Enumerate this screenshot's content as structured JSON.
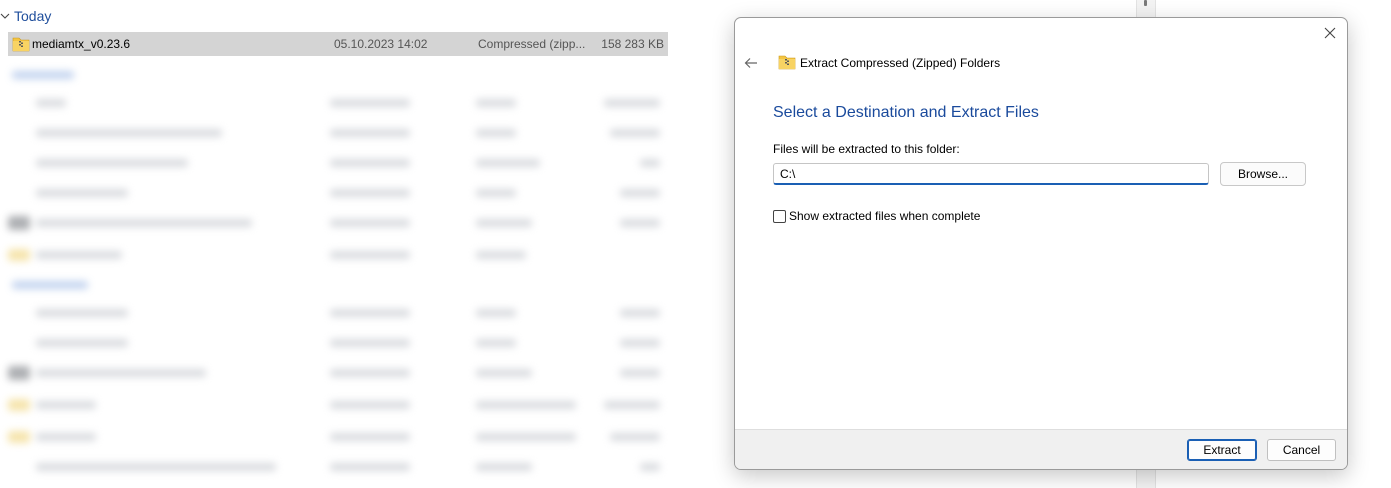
{
  "explorer": {
    "group_header": "Today",
    "selected_file": {
      "name": "mediamtx_v0.23.6",
      "date_modified": "05.10.2023 14:02",
      "type": "Compressed (zipp...",
      "size": "158 283 KB",
      "icon": "zipped-folder-icon"
    }
  },
  "dialog": {
    "title": "Extract Compressed (Zipped) Folders",
    "title_icon": "zipped-folder-icon",
    "heading": "Select a Destination and Extract Files",
    "destination_label": "Files will be extracted to this folder:",
    "destination_value": "C:\\",
    "browse_label": "Browse...",
    "show_files_label": "Show extracted files when complete",
    "show_files_checked": false,
    "extract_label": "Extract",
    "cancel_label": "Cancel"
  },
  "colors": {
    "accent": "#1a5fb4",
    "heading": "#1a4a9c",
    "selection": "#d4d4d4",
    "footer": "#f0f0f0"
  }
}
